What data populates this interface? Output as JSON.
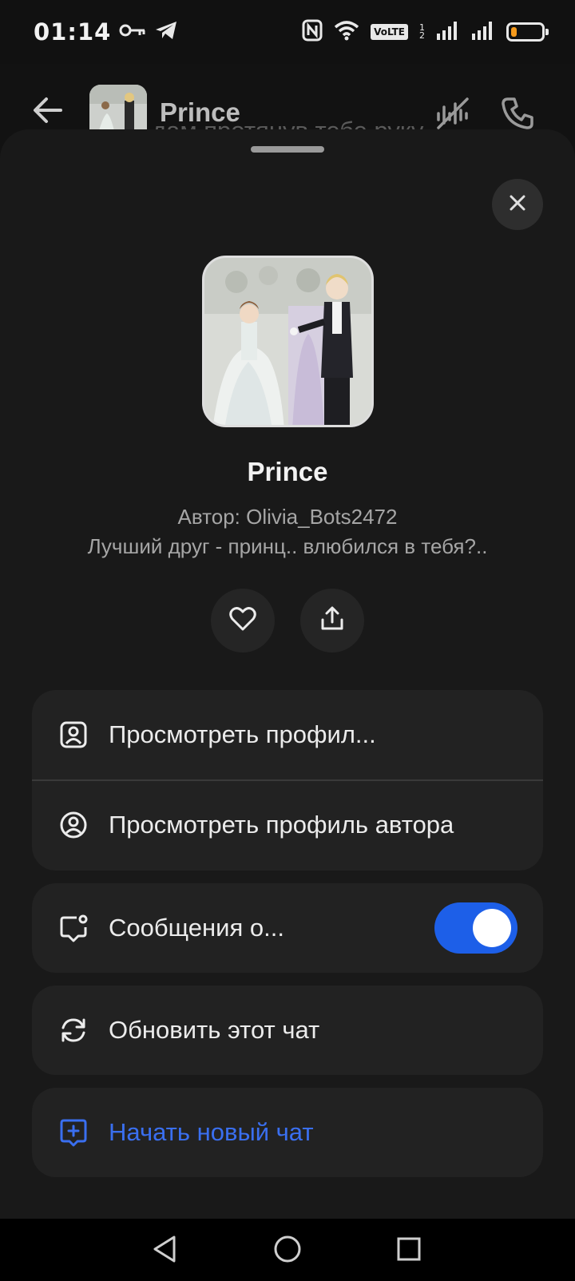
{
  "status_bar": {
    "time": "01:14",
    "volte": "VoLTE",
    "sim_slot": "1\n2",
    "battery_color": "#f59a1c",
    "battery_level": 0.2,
    "icons": [
      "key-icon",
      "telegram-icon",
      "nfc-icon",
      "wifi-icon",
      "signal-icon",
      "signal-icon",
      "battery-icon"
    ]
  },
  "chat_header": {
    "title": "Prince",
    "background_text": "дам протянув тебе руку"
  },
  "sheet": {
    "bot_name": "Prince",
    "author": "Автор: Olivia_Bots2472",
    "tagline": "Лучший друг - принц.. влюбился в тебя?..",
    "actions": {
      "view_profile": "Просмотреть профил...",
      "view_author_profile": "Просмотреть профиль автора",
      "messages": "Сообщения о...",
      "messages_toggle_on": true,
      "refresh_chat": "Обновить этот чат",
      "new_chat": "Начать новый чат"
    },
    "accent_color": "#3a6ff0",
    "toggle_color": "#1d5fe8"
  }
}
